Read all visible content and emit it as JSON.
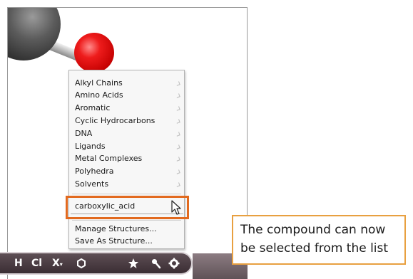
{
  "menu": {
    "submenus": [
      {
        "label": "Alkyl Chains"
      },
      {
        "label": "Amino Acids"
      },
      {
        "label": "Aromatic"
      },
      {
        "label": "Cyclic Hydrocarbons"
      },
      {
        "label": "DNA"
      },
      {
        "label": "Ligands"
      },
      {
        "label": "Metal Complexes"
      },
      {
        "label": "Polyhedra"
      },
      {
        "label": "Solvents"
      }
    ],
    "custom_structure": "carboxylic_acid",
    "manage_label": "Manage Structures...",
    "save_label": "Save As Structure..."
  },
  "toolbar": {
    "hydrogen": "H",
    "chlorine": "Cl",
    "element_picker": "X",
    "element_picker_suffix": "▾",
    "ring_icon": "ring-icon",
    "star_icon": "star-icon",
    "wand_icon": "wand-icon",
    "gear_icon": "gear-icon"
  },
  "callout": {
    "line1": "The compound can now",
    "line2": "be selected from the list"
  },
  "colors": {
    "highlight": "#e26a1f",
    "callout_border": "#e8a040",
    "oxygen_atom": "#ee1c1c",
    "carbon_atom": "#333333"
  }
}
